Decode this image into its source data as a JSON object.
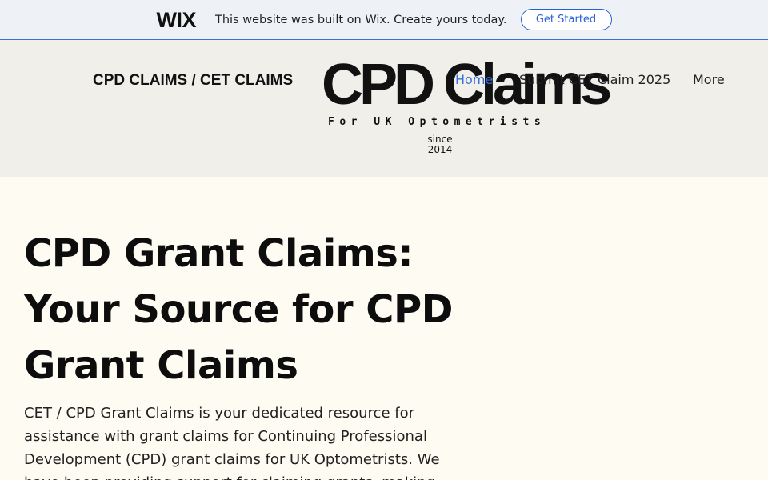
{
  "wix_bar": {
    "logo": "WIX",
    "message": "This website was built on Wix. Create yours today.",
    "cta_label": "Get Started"
  },
  "header": {
    "site_title": "CPD CLAIMS / CET CLAIMS",
    "logo": {
      "main": "CPD Claims",
      "tagline": "For UK Optometrists",
      "since": "since",
      "year": "2014"
    },
    "nav": {
      "home": "Home",
      "submit": "Submit CET Claim 2025",
      "more": "More"
    }
  },
  "hero": {
    "title": "CPD Grant Claims: Your Source for CPD Grant Claims",
    "body": "CET / CPD Grant Claims is your dedicated resource for assistance with grant claims for Continuing Professional Development (CPD) grant claims for UK Optometrists. We have been providing support for claiming grants, making"
  },
  "colors": {
    "accent": "#3a6fd8",
    "header_bg": "#f1efea",
    "page_bg": "#fdfbf2"
  }
}
